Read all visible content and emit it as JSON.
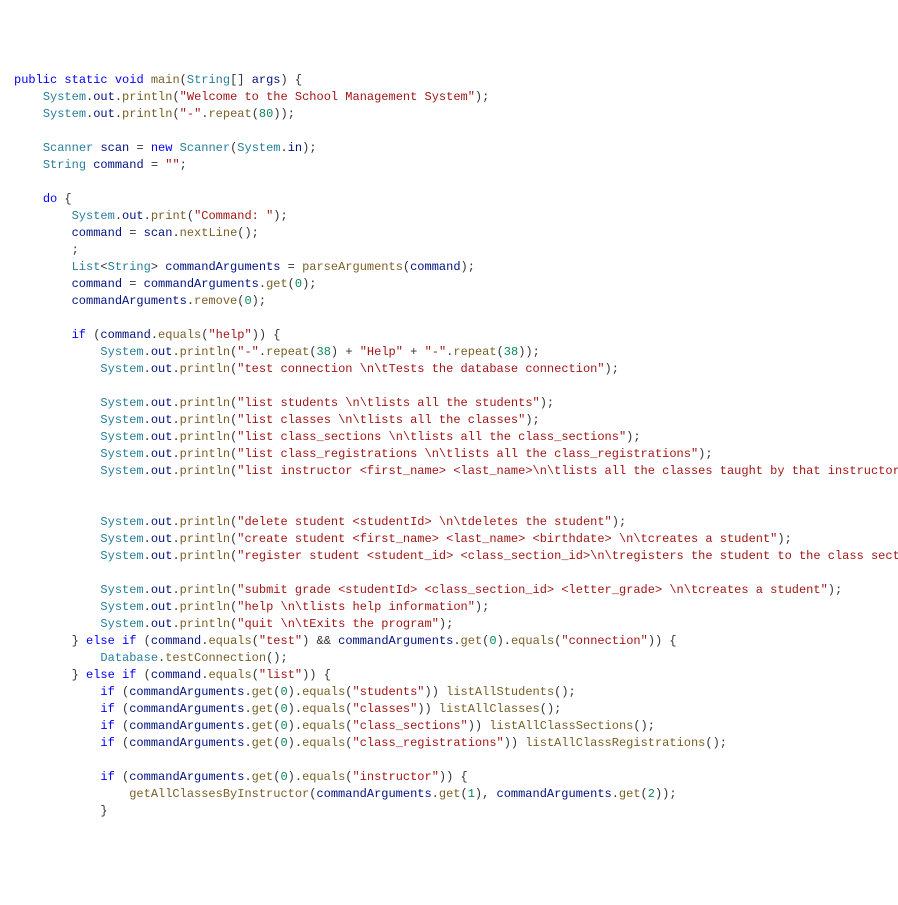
{
  "code": {
    "sig_public": "public",
    "sig_static": "static",
    "sig_void": "void",
    "sig_main": "main",
    "sig_String": "String",
    "sig_args": "args",
    "welcome_str": "\"Welcome to the School Management System\"",
    "dash_str": "\"-\"",
    "repeat80": "80",
    "Scanner": "Scanner",
    "System": "System",
    "in": "in",
    "scan": "scan",
    "new": "new",
    "String_type": "String",
    "command": "command",
    "empty_str": "\"\"",
    "do": "do",
    "out": "out",
    "print": "print",
    "println": "println",
    "prompt_str": "\"Command: \"",
    "nextLine": "nextLine",
    "List": "List",
    "commandArguments": "commandArguments",
    "parseArguments": "parseArguments",
    "get": "get",
    "remove": "remove",
    "repeat": "repeat",
    "zero": "0",
    "one": "1",
    "two": "2",
    "r38": "38",
    "if": "if",
    "else": "else",
    "equals": "equals",
    "help_str": "\"help\"",
    "Help_str": "\"Help\"",
    "plus": " + ",
    "test_conn_str": "\"test connection \\n\\tTests the database connection\"",
    "list_students_str": "\"list students \\n\\tlists all the students\"",
    "list_classes_str": "\"list classes \\n\\tlists all the classes\"",
    "list_class_sections_str": "\"list class_sections \\n\\tlists all the class_sections\"",
    "list_class_registrations_str": "\"list class_registrations \\n\\tlists all the class_registrations\"",
    "list_instructor_str": "\"list instructor <first_name> <last_name>\\n\\tlists all the classes taught by that instructor\"",
    "delete_student_str": "\"delete student <studentId> \\n\\tdeletes the student\"",
    "create_student_str": "\"create student <first_name> <last_name> <birthdate> \\n\\tcreates a student\"",
    "register_student_str": "\"register student <student_id> <class_section_id>\\n\\tregisters the student to the class section\"",
    "submit_grade_str": "\"submit grade <studentId> <class_section_id> <letter_grade> \\n\\tcreates a student\"",
    "help_help_str": "\"help \\n\\tlists help information\"",
    "quit_str": "\"quit \\n\\tExits the program\"",
    "test_lit": "\"test\"",
    "connection_lit": "\"connection\"",
    "list_lit": "\"list\"",
    "students_lit": "\"students\"",
    "classes_lit": "\"classes\"",
    "class_sections_lit": "\"class_sections\"",
    "class_registrations_lit": "\"class_registrations\"",
    "instructor_lit": "\"instructor\"",
    "Database": "Database",
    "testConnection": "testConnection",
    "listAllStudents": "listAllStudents",
    "listAllClasses": "listAllClasses",
    "listAllClassSections": "listAllClassSections",
    "listAllClassRegistrations": "listAllClassRegistrations",
    "getAllClassesByInstructor": "getAllClassesByInstructor",
    "amp": " && "
  }
}
